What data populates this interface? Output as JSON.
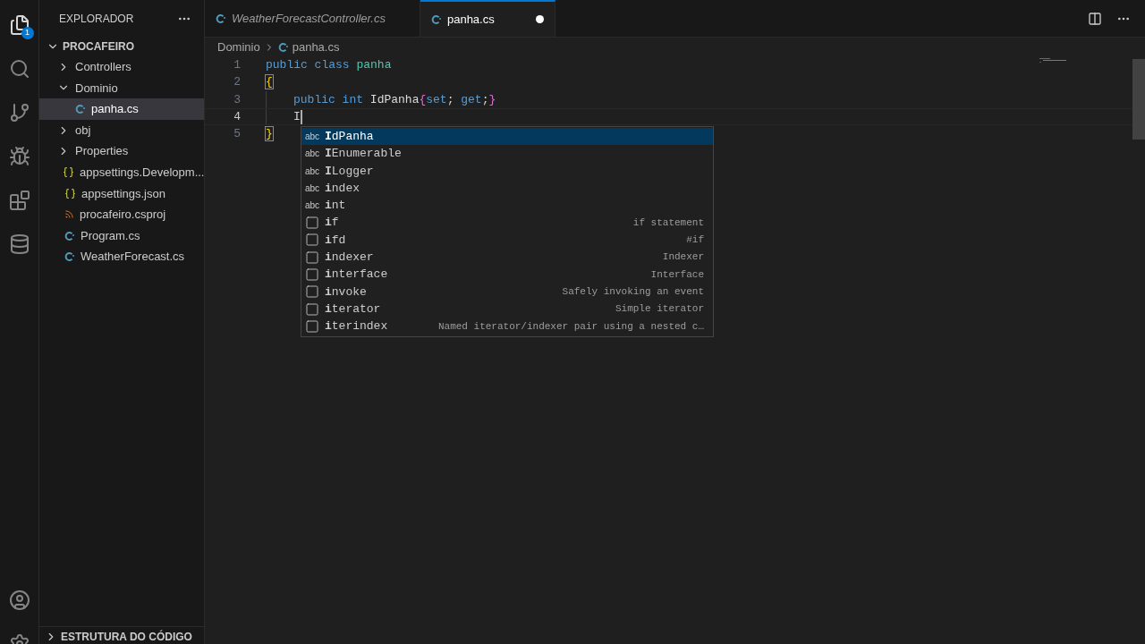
{
  "activity_bar": {
    "badge": "1"
  },
  "explorer": {
    "title": "EXPLORADOR",
    "root": {
      "label": "PROCAFEIRO",
      "expanded": true,
      "children": [
        {
          "label": "Controllers",
          "kind": "folder",
          "expanded": false,
          "selected": false
        },
        {
          "label": "Dominio",
          "kind": "folder",
          "expanded": true,
          "selected": false,
          "children": [
            {
              "label": "panha.cs",
              "kind": "csharp",
              "selected": true
            }
          ]
        },
        {
          "label": "obj",
          "kind": "folder",
          "expanded": false,
          "selected": false
        },
        {
          "label": "Properties",
          "kind": "folder",
          "expanded": false,
          "selected": false
        },
        {
          "label": "appsettings.Developm...",
          "kind": "json",
          "selected": false
        },
        {
          "label": "appsettings.json",
          "kind": "json",
          "selected": false
        },
        {
          "label": "procafeiro.csproj",
          "kind": "project",
          "selected": false
        },
        {
          "label": "Program.cs",
          "kind": "csharp",
          "selected": false
        },
        {
          "label": "WeatherForecast.cs",
          "kind": "csharp",
          "selected": false
        }
      ]
    },
    "outline": {
      "label": "ESTRUTURA DO CÓDIGO",
      "expanded": false
    }
  },
  "tabs": [
    {
      "label": "WeatherForecastController.cs",
      "selected": false,
      "preview": true,
      "dirty": false
    },
    {
      "label": "panha.cs",
      "selected": true,
      "preview": false,
      "dirty": true
    }
  ],
  "breadcrumbs": [
    {
      "label": "Dominio",
      "kind": "folder"
    },
    {
      "label": "panha.cs",
      "kind": "csharp"
    }
  ],
  "code": [
    {
      "number": "1",
      "current": false,
      "indent": false,
      "tokens": [
        {
          "kind": "keyword",
          "text": "public class "
        },
        {
          "kind": "type",
          "text": "panha"
        }
      ]
    },
    {
      "number": "2",
      "current": false,
      "indent": false,
      "tokens": [
        {
          "kind": "bracket-match",
          "text": "{"
        }
      ]
    },
    {
      "number": "3",
      "current": false,
      "indent": true,
      "tokens": [
        {
          "kind": "keyword",
          "text": "public int "
        },
        {
          "kind": "name",
          "text": "IdPanha"
        },
        {
          "kind": "bracket2",
          "text": "{"
        },
        {
          "kind": "keyword",
          "text": "set"
        },
        {
          "kind": "plain",
          "text": "; "
        },
        {
          "kind": "keyword",
          "text": "get"
        },
        {
          "kind": "plain",
          "text": ";"
        },
        {
          "kind": "bracket2",
          "text": "}"
        }
      ]
    },
    {
      "number": "4",
      "current": true,
      "indent": true,
      "tokens": [
        {
          "kind": "plain",
          "text": "I"
        }
      ]
    },
    {
      "number": "5",
      "current": false,
      "indent": false,
      "tokens": [
        {
          "kind": "bracket-match",
          "text": "}"
        }
      ]
    }
  ],
  "suggestions": [
    {
      "kind": "word",
      "icon_label": "abc",
      "label": "**I**dPanha",
      "selected": true
    },
    {
      "kind": "word",
      "icon_label": "abc",
      "label": "**I**Enumerable",
      "selected": false
    },
    {
      "kind": "word",
      "icon_label": "abc",
      "label": "**I**Logger",
      "selected": false
    },
    {
      "kind": "word",
      "icon_label": "abc",
      "label": "**i**ndex",
      "selected": false
    },
    {
      "kind": "word",
      "icon_label": "abc",
      "label": "**i**nt",
      "selected": false
    },
    {
      "kind": "snippet",
      "label": "**i**f",
      "detail": "if statement",
      "selected": false
    },
    {
      "kind": "snippet",
      "label": "**i**fd",
      "detail": "#if",
      "selected": false
    },
    {
      "kind": "snippet",
      "label": "**i**ndexer",
      "detail": "Indexer",
      "selected": false
    },
    {
      "kind": "snippet",
      "label": "**i**nterface",
      "detail": "Interface",
      "selected": false
    },
    {
      "kind": "snippet",
      "label": "**i**nvoke",
      "detail": "Safely invoking an event",
      "selected": false
    },
    {
      "kind": "snippet",
      "label": "**i**terator",
      "detail": "Simple iterator",
      "selected": false
    },
    {
      "kind": "snippet",
      "label": "**i**terindex",
      "detail": "Named iterator/indexer pair using a nested c…",
      "selected": false
    }
  ]
}
